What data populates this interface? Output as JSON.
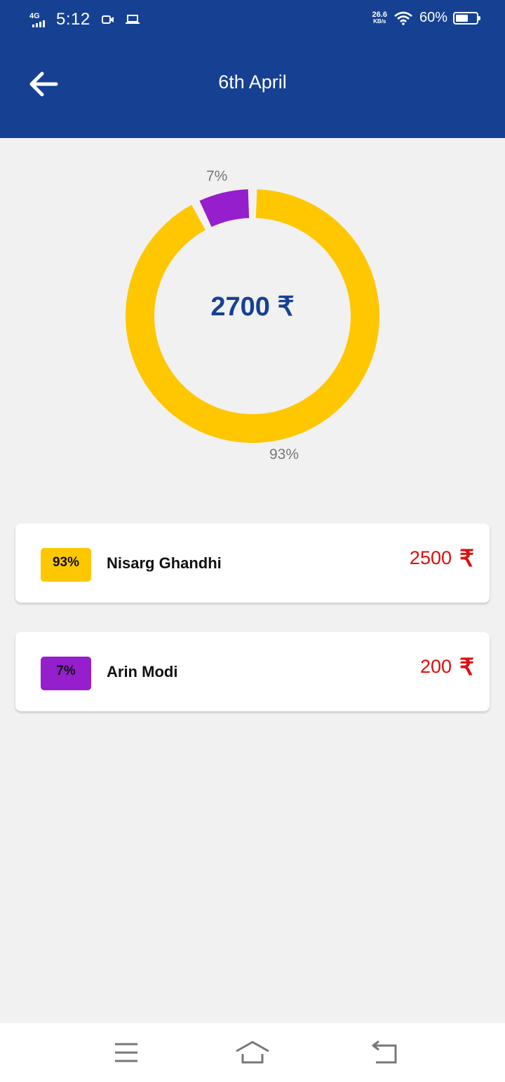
{
  "status_bar": {
    "network": "4G",
    "time": "5:12",
    "speed_value": "26.6",
    "speed_unit": "KB/s",
    "battery_text": "60%",
    "battery_level": 0.6
  },
  "header": {
    "title": "6th April",
    "background": "#164193"
  },
  "summary": {
    "total": "2700",
    "currency_symbol": "₹"
  },
  "chart_data": {
    "type": "pie",
    "donut": true,
    "categories": [
      "Nisarg Ghandhi",
      "Arin Modi"
    ],
    "values": [
      2500,
      200
    ],
    "percent_labels": [
      "93%",
      "7%"
    ],
    "colors": [
      "#fec700",
      "#951ecd"
    ]
  },
  "entries": [
    {
      "percent": "93%",
      "name": "Nisarg Ghandhi",
      "amount": "2500",
      "currency": "₹",
      "color": "#fec700"
    },
    {
      "percent": "7%",
      "name": "Arin Modi",
      "amount": "200",
      "currency": "₹",
      "color": "#951ecd"
    }
  ],
  "icons": {
    "back": "back-arrow-icon",
    "menu": "menu-icon",
    "home": "home-icon",
    "return": "return-icon"
  }
}
